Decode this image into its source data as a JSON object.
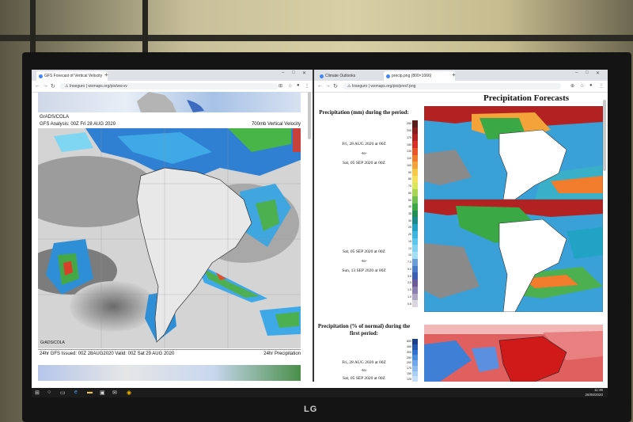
{
  "left_window": {
    "tabs": [
      {
        "title": "GFS Forecast of Vertical Velocity"
      }
    ],
    "new_tab": "+",
    "controls": {
      "minimize": "–",
      "maximize": "□",
      "close": "✕"
    },
    "address": {
      "security": "Inseguro",
      "url": "wxmaps.org/pix/ww.vv"
    },
    "header_left": "GrADS/COLA",
    "header_subtitle_left": "GFS Analysis: 00Z Fri 28 AUG 2020",
    "header_subtitle_right": "700mb Vertical Velocity",
    "map_label": "GrADS/COLA",
    "footer_left": "24hr GFS Issued: 00Z 28AUG2020 Valid: 00Z Sat 29 AUG 2020",
    "footer_right": "24hr Precipitation"
  },
  "right_window": {
    "tabs": [
      {
        "title": "Climate Outlooks"
      },
      {
        "title": "precip.png (800×1066)"
      }
    ],
    "new_tab": "+",
    "controls": {
      "minimize": "–",
      "maximize": "□",
      "close": "✕"
    },
    "address": {
      "security": "Inseguro",
      "url": "wxmaps.org/pix/precf.png"
    },
    "page_title": "Precipitation Forecasts",
    "panel1": {
      "heading": "Precipitation (mm) during the period:",
      "start": "Fri, 28 AUG 2020 at 00Z",
      "to": "-to-",
      "end": "Sat, 05 SEP 2020 at 00Z"
    },
    "panel2": {
      "start": "Sat, 05 SEP 2020 at 00Z",
      "to": "-to-",
      "end": "Sun, 13 SEP 2020 at 00Z"
    },
    "panel3": {
      "heading": "Precipitation (% of normal) during the first period:",
      "start": "Fri, 28 AUG 2020 at 00Z",
      "to": "-to-",
      "end": "Sat, 05 SEP 2020 at 00Z"
    },
    "scale_mm": [
      "250",
      "200",
      "175",
      "150",
      "130",
      "110",
      "100",
      "90",
      "80",
      "70",
      "60",
      "50",
      "40",
      "35",
      "30",
      "25",
      "20",
      "15",
      "13",
      "10",
      "7.5",
      "5.0",
      "3.5",
      "2.5",
      "1.5",
      "1.0",
      "0.8"
    ],
    "scale_pct": [
      "800",
      "400",
      "300",
      "250",
      "200",
      "175",
      "150",
      "125"
    ],
    "colors_mm": [
      "#5a1d1d",
      "#8b1c1c",
      "#b22222",
      "#d73027",
      "#e8562a",
      "#f07c2c",
      "#f4a23a",
      "#f7c846",
      "#f4e05a",
      "#d8e65a",
      "#a8d455",
      "#6fc04f",
      "#3aa845",
      "#1f8f55",
      "#1a8c8c",
      "#20a3c4",
      "#3cb6e0",
      "#5dc6ee",
      "#7fd2f2",
      "#a2dff5",
      "#6a9fd8",
      "#4a7dc7",
      "#3b5fb3",
      "#6a5a9a",
      "#8a7fb0",
      "#b0a9c6",
      "#d9d6e2"
    ],
    "colors_pct": [
      "#1c3f8c",
      "#2457b0",
      "#2f72d0",
      "#4a8fe0",
      "#6fa7ea",
      "#8dbdf1",
      "#a9cff5",
      "#c6e0f8"
    ]
  },
  "taskbar": {
    "time": "11:35",
    "date": "28/08/2020",
    "icons": [
      "windows-start",
      "search",
      "task-view",
      "edge",
      "file-explorer",
      "store",
      "mail",
      "chrome"
    ]
  },
  "monitor_brand": "LG"
}
